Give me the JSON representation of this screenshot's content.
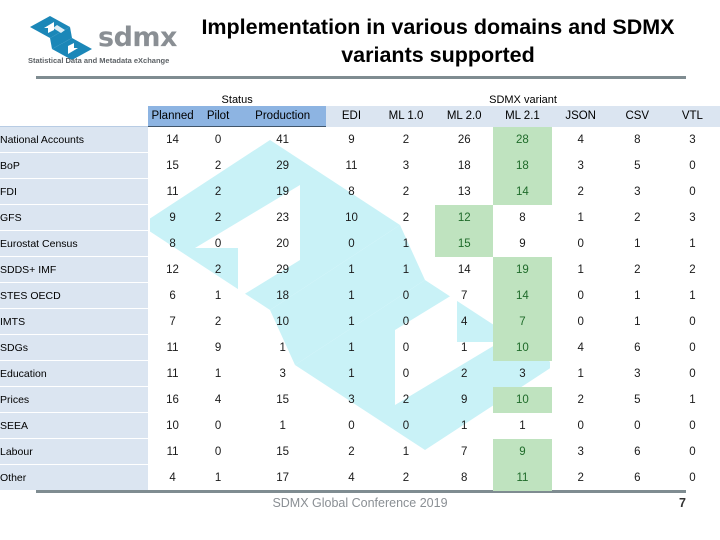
{
  "slide": {
    "title": "Implementation in various domains and SDMX variants supported",
    "footer": "SDMX Global Conference 2019",
    "page_number": "7"
  },
  "logo": {
    "wordmark": "sdmx",
    "tagline": "Statistical Data and Metadata eXchange",
    "mark_color": "#1b87b8",
    "word_color": "#8a8f94"
  },
  "colors": {
    "status_header_bg": "#8db4e2",
    "variant_header_bg": "#dbe5f1",
    "row_label_bg": "#dbe5f1",
    "highlight_bg": "#bfe3bf",
    "highlight_text": "#1f6b2a",
    "rule": "#7f8c91",
    "watermark": "#c9f2f7"
  },
  "table": {
    "group_headers": [
      {
        "label": "Status",
        "span": 3
      },
      {
        "label": "SDMX variant",
        "span": 7
      }
    ],
    "status_columns": [
      "Planned",
      "Pilot",
      "Production"
    ],
    "variant_columns": [
      "EDI",
      "ML 1.0",
      "ML 2.0",
      "ML 2.1",
      "JSON",
      "CSV",
      "VTL"
    ],
    "rows": [
      {
        "domain": "National Accounts",
        "planned": "14",
        "pilot": "0",
        "production": "41",
        "edi": "9",
        "ml10": "2",
        "ml20": "26",
        "ml21": "28",
        "json": "4",
        "csv": "8",
        "vtl": "3",
        "highlight": "ml21"
      },
      {
        "domain": "BoP",
        "planned": "15",
        "pilot": "2",
        "production": "29",
        "edi": "11",
        "ml10": "3",
        "ml20": "18",
        "ml21": "18",
        "json": "3",
        "csv": "5",
        "vtl": "0",
        "highlight": "ml21"
      },
      {
        "domain": "FDI",
        "planned": "11",
        "pilot": "2",
        "production": "19",
        "edi": "8",
        "ml10": "2",
        "ml20": "13",
        "ml21": "14",
        "json": "2",
        "csv": "3",
        "vtl": "0",
        "highlight": "ml21"
      },
      {
        "domain": "GFS",
        "planned": "9",
        "pilot": "2",
        "production": "23",
        "edi": "10",
        "ml10": "2",
        "ml20": "12",
        "ml21": "8",
        "json": "1",
        "csv": "2",
        "vtl": "3",
        "highlight": "ml20"
      },
      {
        "domain": "Eurostat Census",
        "planned": "8",
        "pilot": "0",
        "production": "20",
        "edi": "0",
        "ml10": "1",
        "ml20": "15",
        "ml21": "9",
        "json": "0",
        "csv": "1",
        "vtl": "1",
        "highlight": "ml20"
      },
      {
        "domain": "SDDS+ IMF",
        "planned": "12",
        "pilot": "2",
        "production": "29",
        "edi": "1",
        "ml10": "1",
        "ml20": "14",
        "ml21": "19",
        "json": "1",
        "csv": "2",
        "vtl": "2",
        "highlight": "ml21"
      },
      {
        "domain": "STES OECD",
        "planned": "6",
        "pilot": "1",
        "production": "18",
        "edi": "1",
        "ml10": "0",
        "ml20": "7",
        "ml21": "14",
        "json": "0",
        "csv": "1",
        "vtl": "1",
        "highlight": "ml21"
      },
      {
        "domain": "IMTS",
        "planned": "7",
        "pilot": "2",
        "production": "10",
        "edi": "1",
        "ml10": "0",
        "ml20": "4",
        "ml21": "7",
        "json": "0",
        "csv": "1",
        "vtl": "0",
        "highlight": "ml21"
      },
      {
        "domain": "SDGs",
        "planned": "11",
        "pilot": "9",
        "production": "1",
        "edi": "1",
        "ml10": "0",
        "ml20": "1",
        "ml21": "10",
        "json": "4",
        "csv": "6",
        "vtl": "0",
        "highlight": "ml21"
      },
      {
        "domain": "Education",
        "planned": "11",
        "pilot": "1",
        "production": "3",
        "edi": "1",
        "ml10": "0",
        "ml20": "2",
        "ml21": "3",
        "json": "1",
        "csv": "3",
        "vtl": "0",
        "highlight": ""
      },
      {
        "domain": "Prices",
        "planned": "16",
        "pilot": "4",
        "production": "15",
        "edi": "3",
        "ml10": "2",
        "ml20": "9",
        "ml21": "10",
        "json": "2",
        "csv": "5",
        "vtl": "1",
        "highlight": "ml21"
      },
      {
        "domain": "SEEA",
        "planned": "10",
        "pilot": "0",
        "production": "1",
        "edi": "0",
        "ml10": "0",
        "ml20": "1",
        "ml21": "1",
        "json": "0",
        "csv": "0",
        "vtl": "0",
        "highlight": ""
      },
      {
        "domain": "Labour",
        "planned": "11",
        "pilot": "0",
        "production": "15",
        "edi": "2",
        "ml10": "1",
        "ml20": "7",
        "ml21": "9",
        "json": "3",
        "csv": "6",
        "vtl": "0",
        "highlight": "ml21"
      },
      {
        "domain": "Other",
        "planned": "4",
        "pilot": "1",
        "production": "17",
        "edi": "4",
        "ml10": "2",
        "ml20": "8",
        "ml21": "11",
        "json": "2",
        "csv": "6",
        "vtl": "0",
        "highlight": "ml21"
      }
    ]
  }
}
